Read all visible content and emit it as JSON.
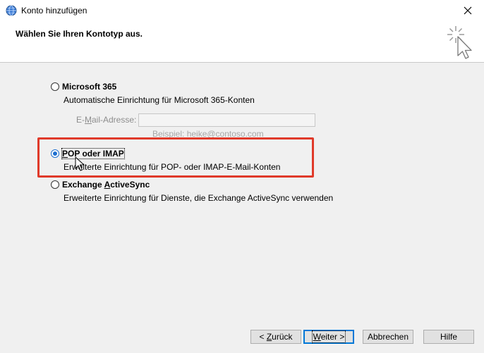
{
  "window": {
    "title": "Konto hinzufügen",
    "close_glyph": "✕"
  },
  "header": {
    "title": "Wählen Sie Ihren Kontotyp aus."
  },
  "options": [
    {
      "label_pre": "",
      "label_mnemonic": "",
      "label_post": "Microsoft 365",
      "description": "Automatische Einrichtung für Microsoft 365-Konten",
      "selected": false
    },
    {
      "label_pre": "",
      "label_mnemonic": "P",
      "label_post": "OP oder IMAP",
      "description": "Erweiterte Einrichtung für POP- oder IMAP-E-Mail-Konten",
      "selected": true
    },
    {
      "label_pre": "Exchange ",
      "label_mnemonic": "A",
      "label_post": "ctiveSync",
      "description": "Erweiterte Einrichtung für Dienste, die Exchange ActiveSync verwenden",
      "selected": false
    }
  ],
  "email": {
    "label_pre": "E-",
    "label_mnemonic": "M",
    "label_post": "ail-Adresse:",
    "value": "",
    "example": "Beispiel: heike@contoso.com"
  },
  "buttons": {
    "back": {
      "pre": "< ",
      "mnemonic": "Z",
      "post": "urück"
    },
    "next": {
      "pre": "",
      "mnemonic": "W",
      "post": "eiter >"
    },
    "cancel": {
      "label": "Abbrechen"
    },
    "help": {
      "label": "Hilfe"
    }
  },
  "colors": {
    "highlight": "#e03a2a",
    "accent": "#0078d7",
    "radio_selected": "#1e6fcf"
  },
  "icons": [
    "outlook-globe-icon",
    "close-icon",
    "wizard-sparkle-cursor-icon",
    "mouse-cursor-icon"
  ]
}
